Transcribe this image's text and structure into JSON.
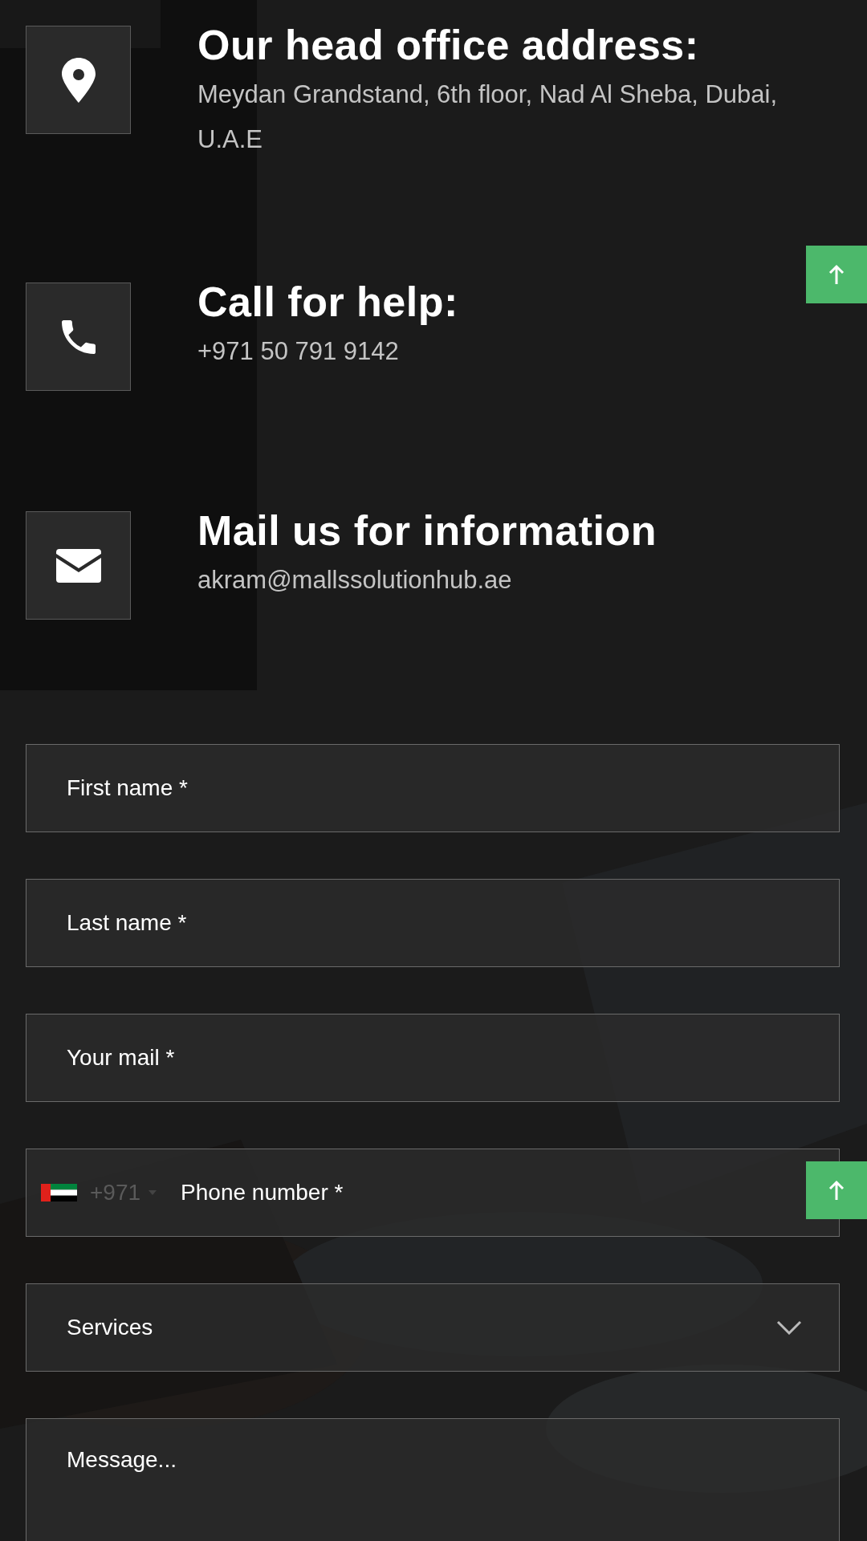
{
  "contacts": [
    {
      "kind": "location",
      "heading": "Our head office address:",
      "text": "Meydan Grandstand, 6th floor, Nad Al Sheba, Dubai, U.A.E"
    },
    {
      "kind": "phone",
      "heading": "Call for help:",
      "text": "+971 50 791 9142"
    },
    {
      "kind": "mail",
      "heading": "Mail us for information",
      "text": "akram@mallssolutionhub.ae"
    }
  ],
  "form": {
    "fields": [
      {
        "kind": "text",
        "placeholder": "First name *"
      },
      {
        "kind": "text",
        "placeholder": "Last name *"
      },
      {
        "kind": "text",
        "placeholder": "Your mail *"
      },
      {
        "kind": "phone",
        "dial_code": "+971",
        "placeholder": "Phone number *"
      },
      {
        "kind": "select",
        "value": "Services"
      },
      {
        "kind": "textarea",
        "placeholder": "Message..."
      }
    ]
  }
}
